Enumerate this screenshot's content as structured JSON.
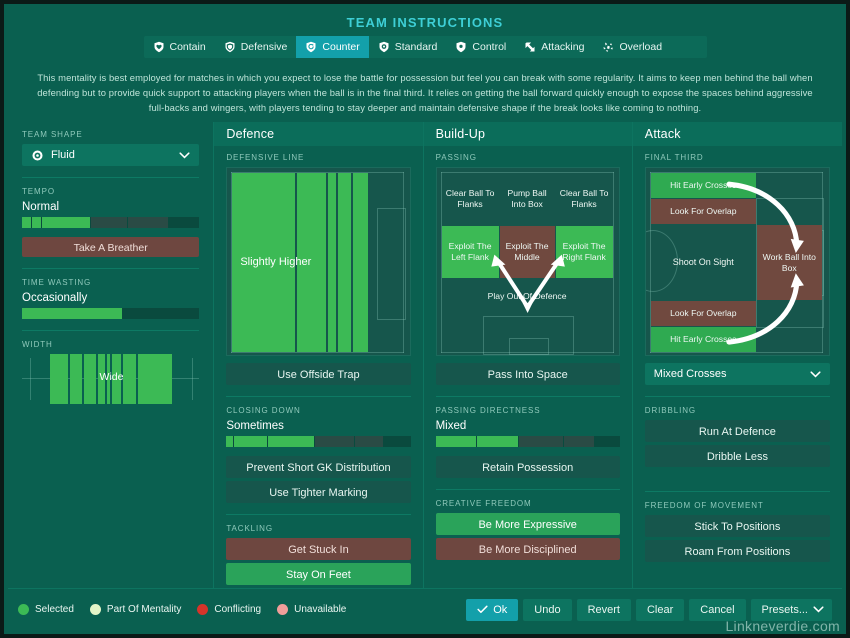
{
  "header": {
    "title": "TEAM INSTRUCTIONS",
    "mentalities": [
      {
        "label": "Contain",
        "icon": "shield-heart-icon",
        "active": false
      },
      {
        "label": "Defensive",
        "icon": "shield-icon",
        "active": false
      },
      {
        "label": "Counter",
        "icon": "counter-arrow-icon",
        "active": true
      },
      {
        "label": "Standard",
        "icon": "shield-circle-icon",
        "active": false
      },
      {
        "label": "Control",
        "icon": "shield-ball-icon",
        "active": false
      },
      {
        "label": "Attacking",
        "icon": "arrow-up-left-icon",
        "active": false
      },
      {
        "label": "Overload",
        "icon": "burst-icon",
        "active": false
      }
    ],
    "description": "This mentality is best employed for matches in which you expect to lose the battle for possession but feel you can break with some regularity.  It aims to keep men behind the ball when defending but to provide quick support to attacking players when the ball is in the final third. It relies on getting the ball forward quickly enough to expose the spaces behind aggressive full-backs and wingers, with players tending to stay deeper and maintain defensive shape if the break looks like coming to nothing."
  },
  "sidebar": {
    "team_shape": {
      "label": "TEAM SHAPE",
      "value": "Fluid",
      "icon": "target-icon",
      "chevron": "chevron-down-icon"
    },
    "tempo": {
      "label": "TEMPO",
      "value": "Normal",
      "button": "Take A Breather"
    },
    "time_wasting": {
      "label": "TIME WASTING",
      "value": "Occasionally"
    },
    "width": {
      "label": "WIDTH",
      "value": "Wide"
    }
  },
  "defence": {
    "title": "Defence",
    "defensive_line": {
      "label": "DEFENSIVE LINE",
      "value": "Slightly Higher",
      "button": "Use Offside Trap"
    },
    "closing_down": {
      "label": "CLOSING DOWN",
      "value": "Sometimes",
      "buttons": [
        {
          "label": "Prevent Short GK Distribution",
          "state": "normal"
        },
        {
          "label": "Use Tighter Marking",
          "state": "normal"
        }
      ]
    },
    "tackling": {
      "label": "TACKLING",
      "buttons": [
        {
          "label": "Get Stuck In",
          "state": "conflicting"
        },
        {
          "label": "Stay On Feet",
          "state": "mentality"
        }
      ]
    }
  },
  "buildup": {
    "title": "Build-Up",
    "passing": {
      "label": "PASSING",
      "cells": [
        {
          "label": "Clear Ball To Flanks",
          "state": "plain"
        },
        {
          "label": "Pump Ball Into Box",
          "state": "plain"
        },
        {
          "label": "Clear Ball To Flanks",
          "state": "plain"
        },
        {
          "label": "Exploit The Left Flank",
          "state": "selected"
        },
        {
          "label": "Exploit The Middle",
          "state": "conflicting"
        },
        {
          "label": "Exploit The Right Flank",
          "state": "selected"
        },
        {
          "label": "Play Out Of Defence",
          "state": "plain"
        }
      ],
      "button": "Pass Into Space"
    },
    "passing_directness": {
      "label": "PASSING DIRECTNESS",
      "value": "Mixed",
      "button": "Retain Possession"
    },
    "creative_freedom": {
      "label": "CREATIVE FREEDOM",
      "buttons": [
        {
          "label": "Be More Expressive",
          "state": "mentality"
        },
        {
          "label": "Be More Disciplined",
          "state": "conflicting"
        }
      ]
    }
  },
  "attack": {
    "title": "Attack",
    "final_third": {
      "label": "FINAL THIRD",
      "cells": [
        {
          "label": "Hit Early Crosses",
          "state": "mentality"
        },
        {
          "label": "Look For Overlap",
          "state": "conflicting"
        },
        {
          "label": "Shoot On Sight",
          "state": "plain"
        },
        {
          "label": "Work Ball Into Box",
          "state": "conflicting"
        },
        {
          "label": "Look For Overlap",
          "state": "conflicting"
        },
        {
          "label": "Hit Early Crosses",
          "state": "mentality"
        }
      ],
      "crosses": {
        "value": "Mixed Crosses",
        "chevron": "chevron-down-icon"
      }
    },
    "dribbling": {
      "label": "DRIBBLING",
      "buttons": [
        {
          "label": "Run At Defence",
          "state": "normal"
        },
        {
          "label": "Dribble Less",
          "state": "normal"
        }
      ]
    },
    "freedom_of_movement": {
      "label": "FREEDOM OF MOVEMENT",
      "buttons": [
        {
          "label": "Stick To Positions",
          "state": "normal"
        },
        {
          "label": "Roam From Positions",
          "state": "normal"
        }
      ]
    }
  },
  "footer": {
    "legend": [
      {
        "label": "Selected",
        "color": "#3cba55"
      },
      {
        "label": "Part Of Mentality",
        "color": "#e3f5c8"
      },
      {
        "label": "Conflicting",
        "color": "#d6342a"
      },
      {
        "label": "Unavailable",
        "color": "#f09e9a"
      }
    ],
    "buttons": [
      {
        "label": "Ok",
        "primary": true,
        "icon": "check-icon"
      },
      {
        "label": "Undo",
        "primary": false
      },
      {
        "label": "Revert",
        "primary": false
      },
      {
        "label": "Clear",
        "primary": false
      },
      {
        "label": "Cancel",
        "primary": false
      },
      {
        "label": "Presets...",
        "primary": false,
        "icon": "chevron-down-icon"
      }
    ],
    "watermark": "Linkneverdie.com"
  },
  "colors": {
    "background": "#0a6050",
    "accent": "#13a0aa",
    "selected": "#3cba55",
    "conflicting": "#70493f",
    "panel": "#16564c"
  }
}
